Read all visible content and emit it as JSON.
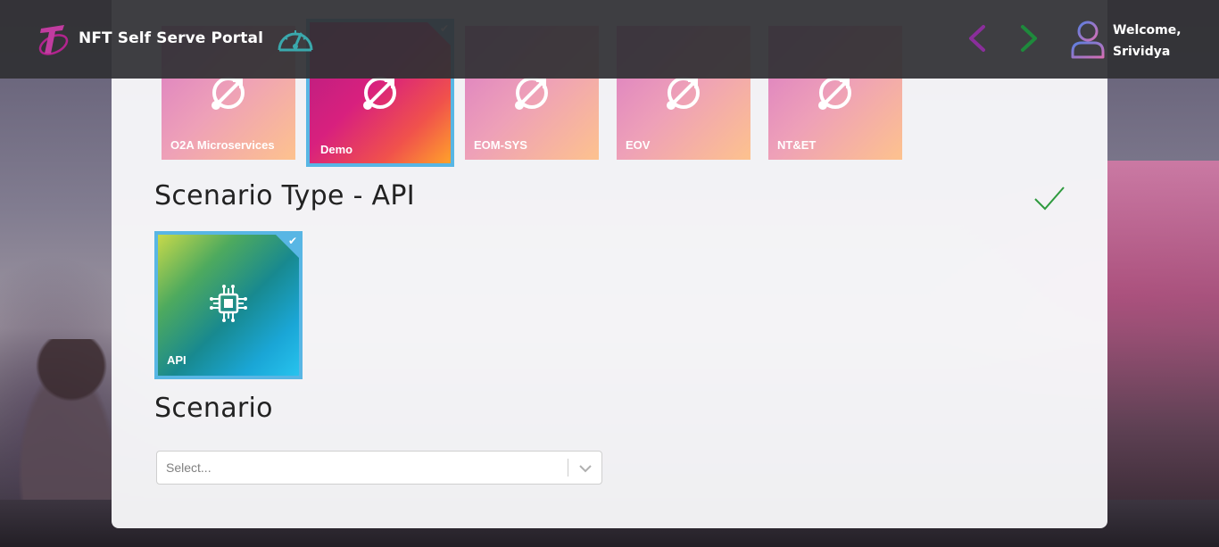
{
  "header": {
    "app_title": "NFT Self Serve Portal",
    "welcome_line1": "Welcome,",
    "welcome_line2": "Srividya",
    "icons": {
      "logo": "telstra-logo-icon",
      "dashboard": "speedometer-icon",
      "prev": "chevron-left-icon",
      "next": "chevron-right-icon",
      "user": "user-icon"
    },
    "colors": {
      "prev_arrow": "#8a2e9b",
      "next_arrow": "#1e8a3c",
      "speed_icon": "#3aa9ad",
      "user_icon": "#8a7fd6"
    }
  },
  "applications": [
    {
      "label": "O2A Microservices",
      "selected": false
    },
    {
      "label": "Demo",
      "selected": true
    },
    {
      "label": "EOM-SYS",
      "selected": false
    },
    {
      "label": "EOV",
      "selected": false
    },
    {
      "label": "NT&ET",
      "selected": false
    }
  ],
  "scenario_type": {
    "title": "Scenario Type - API",
    "done_icon": "check-icon",
    "done_color": "#2e9a3e",
    "tiles": [
      {
        "label": "API",
        "selected": true,
        "icon": "chip-icon"
      }
    ]
  },
  "scenario": {
    "title": "Scenario",
    "select_placeholder": "Select..."
  },
  "colors": {
    "selection_border": "#58b6e4"
  }
}
